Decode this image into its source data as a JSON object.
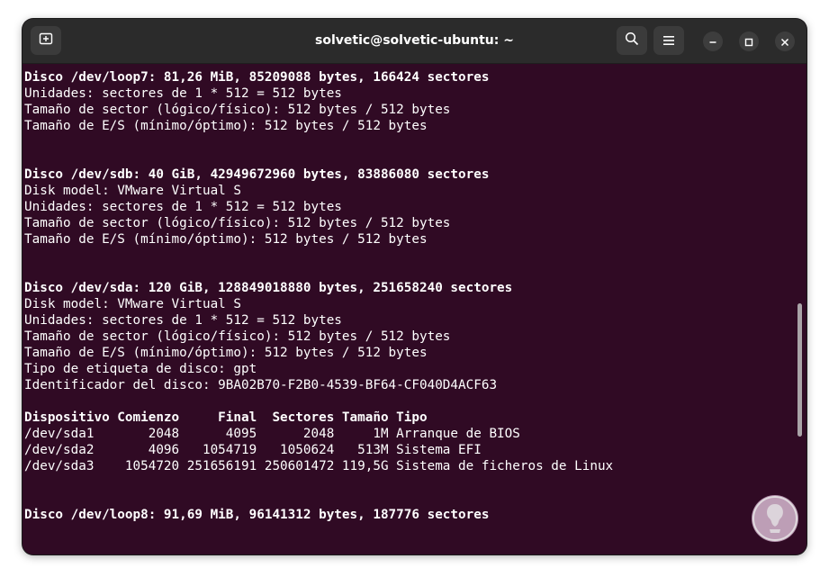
{
  "window": {
    "title": "solvetic@solvetic-ubuntu: ~"
  },
  "icons": {
    "new_tab": "new-tab-icon",
    "search": "search-icon",
    "menu": "hamburger-menu-icon",
    "minimize": "minimize-icon",
    "maximize": "maximize-icon",
    "close": "close-icon",
    "watermark": "solvetic-logo-icon"
  },
  "colors": {
    "terminal_bg": "#300a24",
    "titlebar_bg": "#2b2b2b",
    "text": "#ffffff"
  },
  "terminal": {
    "lines": [
      {
        "text": "Disco /dev/loop7: 81,26 MiB, 85209088 bytes, 166424 sectores",
        "bold": true
      },
      {
        "text": "Unidades: sectores de 1 * 512 = 512 bytes",
        "bold": false
      },
      {
        "text": "Tamaño de sector (lógico/físico): 512 bytes / 512 bytes",
        "bold": false
      },
      {
        "text": "Tamaño de E/S (mínimo/óptimo): 512 bytes / 512 bytes",
        "bold": false
      },
      {
        "text": "",
        "bold": false
      },
      {
        "text": "",
        "bold": false
      },
      {
        "text": "Disco /dev/sdb: 40 GiB, 42949672960 bytes, 83886080 sectores",
        "bold": true
      },
      {
        "text": "Disk model: VMware Virtual S",
        "bold": false
      },
      {
        "text": "Unidades: sectores de 1 * 512 = 512 bytes",
        "bold": false
      },
      {
        "text": "Tamaño de sector (lógico/físico): 512 bytes / 512 bytes",
        "bold": false
      },
      {
        "text": "Tamaño de E/S (mínimo/óptimo): 512 bytes / 512 bytes",
        "bold": false
      },
      {
        "text": "",
        "bold": false
      },
      {
        "text": "",
        "bold": false
      },
      {
        "text": "Disco /dev/sda: 120 GiB, 128849018880 bytes, 251658240 sectores",
        "bold": true
      },
      {
        "text": "Disk model: VMware Virtual S",
        "bold": false
      },
      {
        "text": "Unidades: sectores de 1 * 512 = 512 bytes",
        "bold": false
      },
      {
        "text": "Tamaño de sector (lógico/físico): 512 bytes / 512 bytes",
        "bold": false
      },
      {
        "text": "Tamaño de E/S (mínimo/óptimo): 512 bytes / 512 bytes",
        "bold": false
      },
      {
        "text": "Tipo de etiqueta de disco: gpt",
        "bold": false
      },
      {
        "text": "Identificador del disco: 9BA02B70-F2B0-4539-BF64-CF040D4ACF63",
        "bold": false
      },
      {
        "text": "",
        "bold": false
      },
      {
        "text": "Dispositivo Comienzo     Final  Sectores Tamaño Tipo",
        "bold": true
      },
      {
        "text": "/dev/sda1       2048      4095      2048     1M Arranque de BIOS",
        "bold": false
      },
      {
        "text": "/dev/sda2       4096   1054719   1050624   513M Sistema EFI",
        "bold": false
      },
      {
        "text": "/dev/sda3    1054720 251656191 250601472 119,5G Sistema de ficheros de Linux",
        "bold": false
      },
      {
        "text": "",
        "bold": false
      },
      {
        "text": "",
        "bold": false
      },
      {
        "text": "Disco /dev/loop8: 91,69 MiB, 96141312 bytes, 187776 sectores",
        "bold": true
      }
    ]
  }
}
